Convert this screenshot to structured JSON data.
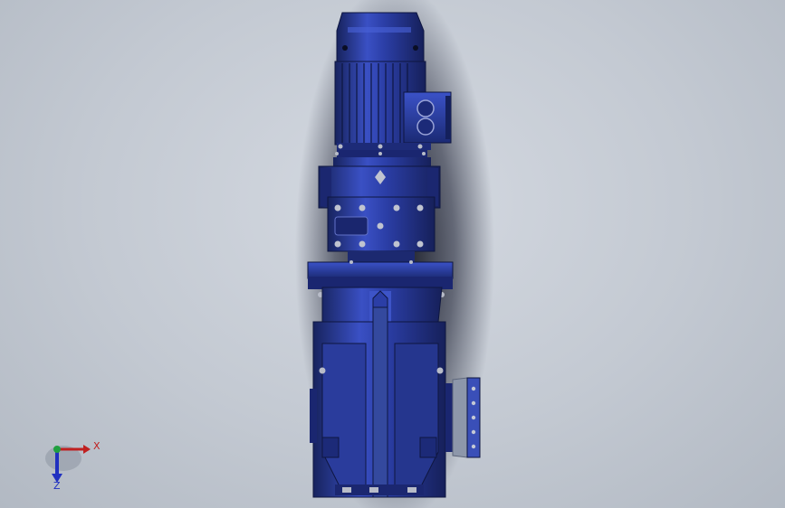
{
  "viewport": {
    "background_top": "#d4d9e1",
    "background_bottom": "#b2b9c3"
  },
  "colors": {
    "body_blue": "#2a3c9c",
    "highlight_blue": "#4a62d8",
    "dark_blue": "#14205c",
    "shadow": "#0b0f22",
    "bolt": "#b8bcc8",
    "axis_x": "#c02020",
    "axis_y": "#20a040",
    "axis_z": "#2030c0"
  },
  "triad": {
    "x_label": "X",
    "z_label": "Z",
    "icon": "coordinate-triad-icon"
  }
}
